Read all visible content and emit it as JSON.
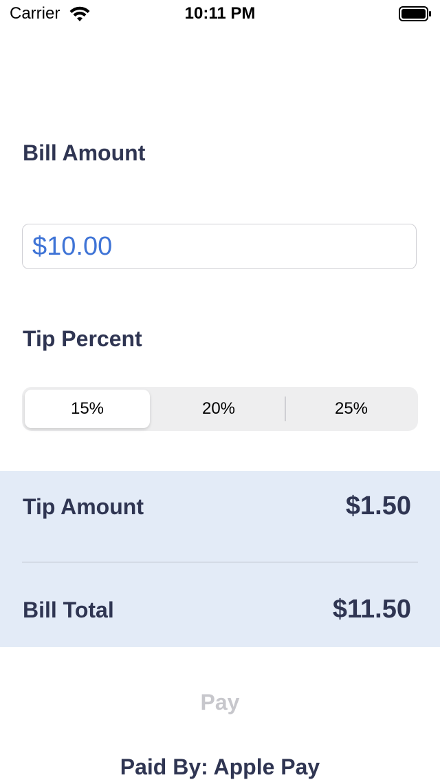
{
  "status_bar": {
    "carrier": "Carrier",
    "time": "10:11 PM",
    "wifi_icon": "wifi-icon",
    "battery_icon": "battery-icon"
  },
  "bill": {
    "label": "Bill Amount",
    "value": "$10.00"
  },
  "tip": {
    "label": "Tip Percent",
    "options": [
      "15%",
      "20%",
      "25%"
    ],
    "selected_index": 0
  },
  "totals": {
    "tip_amount_label": "Tip Amount",
    "tip_amount_value": "$1.50",
    "bill_total_label": "Bill Total",
    "bill_total_value": "$11.50"
  },
  "pay": {
    "label": "Pay",
    "paid_by": "Paid By: Apple Pay"
  },
  "colors": {
    "text_primary": "#2f3552",
    "input_text": "#3f74d6",
    "panel_background": "#e3ebf7",
    "pay_disabled": "#c7c7cc"
  }
}
